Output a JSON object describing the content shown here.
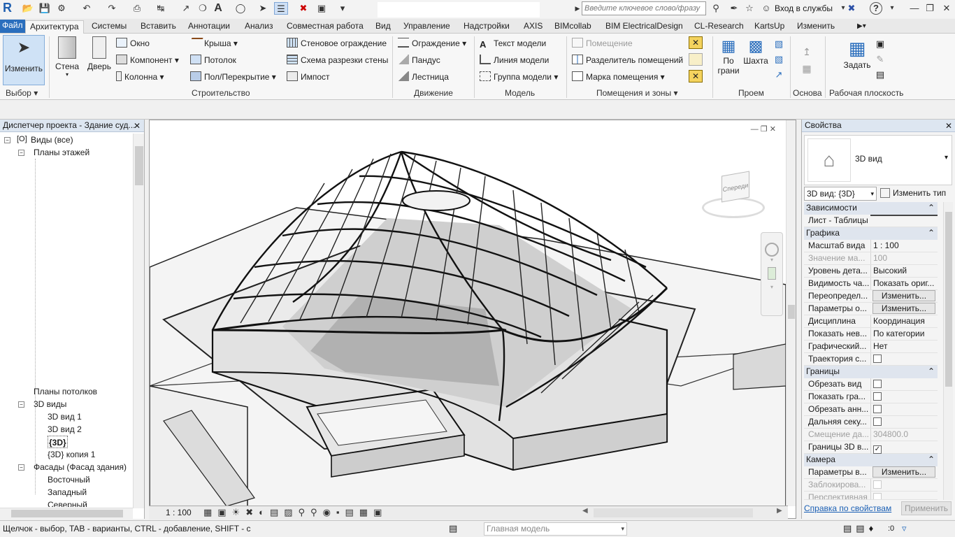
{
  "app": {
    "logo_letter": "R"
  },
  "quick_access": {
    "search_placeholder": "Введите ключевое слово/фразу",
    "signin_label": "Вход в службы",
    "help_label": "?"
  },
  "tabs": [
    {
      "label": "Файл"
    },
    {
      "label": "Архитектура"
    },
    {
      "label": "Системы"
    },
    {
      "label": "Вставить"
    },
    {
      "label": "Аннотации"
    },
    {
      "label": "Анализ"
    },
    {
      "label": "Совместная работа"
    },
    {
      "label": "Вид"
    },
    {
      "label": "Управление"
    },
    {
      "label": "Надстройки"
    },
    {
      "label": "AXIS"
    },
    {
      "label": "BIMcollab"
    },
    {
      "label": "BIM ElectricalDesign"
    },
    {
      "label": "CL-Research"
    },
    {
      "label": "KartsUp"
    },
    {
      "label": "Изменить"
    }
  ],
  "ribbon": {
    "modify": "Изменить",
    "wall": "Стена",
    "door": "Дверь",
    "window": "Окно",
    "component": "Компонент",
    "column": "Колонна",
    "roof": "Крыша",
    "ceiling": "Потолок",
    "floor": "Пол/Перекрытие",
    "curtain_wall": "Стеновое ограждение",
    "curtain_grid": "Схема разрезки стены",
    "mullion": "Импост",
    "railing": "Ограждение",
    "ramp": "Пандус",
    "stair": "Лестница",
    "model_text": "Текст модели",
    "model_line": "Линия модели",
    "model_group": "Группа модели",
    "room": "Помещение",
    "room_separator": "Разделитель помещений",
    "room_tag": "Марка помещения",
    "by_face_1": "По",
    "by_face_2": "грани",
    "shaft": "Шахта",
    "set": "Задать",
    "panels": {
      "select": "Выбор",
      "build": "Строительство",
      "circulation": "Движение",
      "model": "Модель",
      "room_area": "Помещения и зоны",
      "opening": "Проем",
      "datum": "Основа",
      "work_plane": "Рабочая плоскость"
    }
  },
  "project_browser": {
    "title": "Диспетчер проекта - Здание суд...",
    "items": [
      {
        "label": "Виды (все)"
      },
      {
        "label": "Планы этажей"
      },
      {
        "label": "Планы потолков"
      },
      {
        "label": "3D виды"
      },
      {
        "label": "3D вид 1"
      },
      {
        "label": "3D вид 2"
      },
      {
        "label": "{3D}"
      },
      {
        "label": "{3D} копия 1"
      },
      {
        "label": "Фасады (Фасад здания)"
      },
      {
        "label": "Восточный"
      },
      {
        "label": "Западный"
      },
      {
        "label": "Северный"
      }
    ]
  },
  "viewport": {
    "scale": "1 : 100",
    "viewcube_label": "Спереди"
  },
  "properties": {
    "title": "Свойства",
    "type_name": "3D вид",
    "selector_value": "3D вид: {3D}",
    "edit_type": "Изменить тип",
    "groups": {
      "constraints": "Зависимости",
      "graphics": "Графика",
      "extents": "Границы",
      "camera": "Камера"
    },
    "rows": {
      "sheet": {
        "k": "Лист - Таблицы",
        "v": ""
      },
      "view_scale": {
        "k": "Масштаб вида",
        "v": "1 : 100"
      },
      "scale_value": {
        "k": "Значение ма...",
        "v": "100"
      },
      "detail_level": {
        "k": "Уровень дета...",
        "v": "Высокий"
      },
      "parts_visibility": {
        "k": "Видимость ча...",
        "v": "Показать ориг..."
      },
      "vg_overrides": {
        "k": "Переопредел...",
        "v": "Изменить..."
      },
      "display_options": {
        "k": "Параметры о...",
        "v": "Изменить..."
      },
      "discipline": {
        "k": "Дисциплина",
        "v": "Координация"
      },
      "show_hidden": {
        "k": "Показать нев...",
        "v": "По категории"
      },
      "graphic_display": {
        "k": "Графический...",
        "v": "Нет"
      },
      "sun_path": {
        "k": "Траектория с...",
        "v": ""
      },
      "crop_view": {
        "k": "Обрезать вид",
        "v": ""
      },
      "crop_visible": {
        "k": "Показать гра...",
        "v": ""
      },
      "annotation_crop": {
        "k": "Обрезать анн...",
        "v": ""
      },
      "far_clip": {
        "k": "Дальняя секу...",
        "v": ""
      },
      "far_clip_offset": {
        "k": "Смещение да...",
        "v": "304800.0"
      },
      "section_box": {
        "k": "Границы 3D в...",
        "v": ""
      },
      "render_settings": {
        "k": "Параметры в...",
        "v": "Изменить..."
      },
      "locked": {
        "k": "Заблокирова...",
        "v": ""
      },
      "perspective": {
        "k": "Перспективная",
        "v": ""
      }
    },
    "help_link": "Справка по свойствам",
    "apply": "Применить"
  },
  "status": {
    "hint": "Щелчок - выбор, TAB - варианты, CTRL - добавление, SHIFT - с",
    "workset": "Главная модель",
    "zero": ":0"
  }
}
